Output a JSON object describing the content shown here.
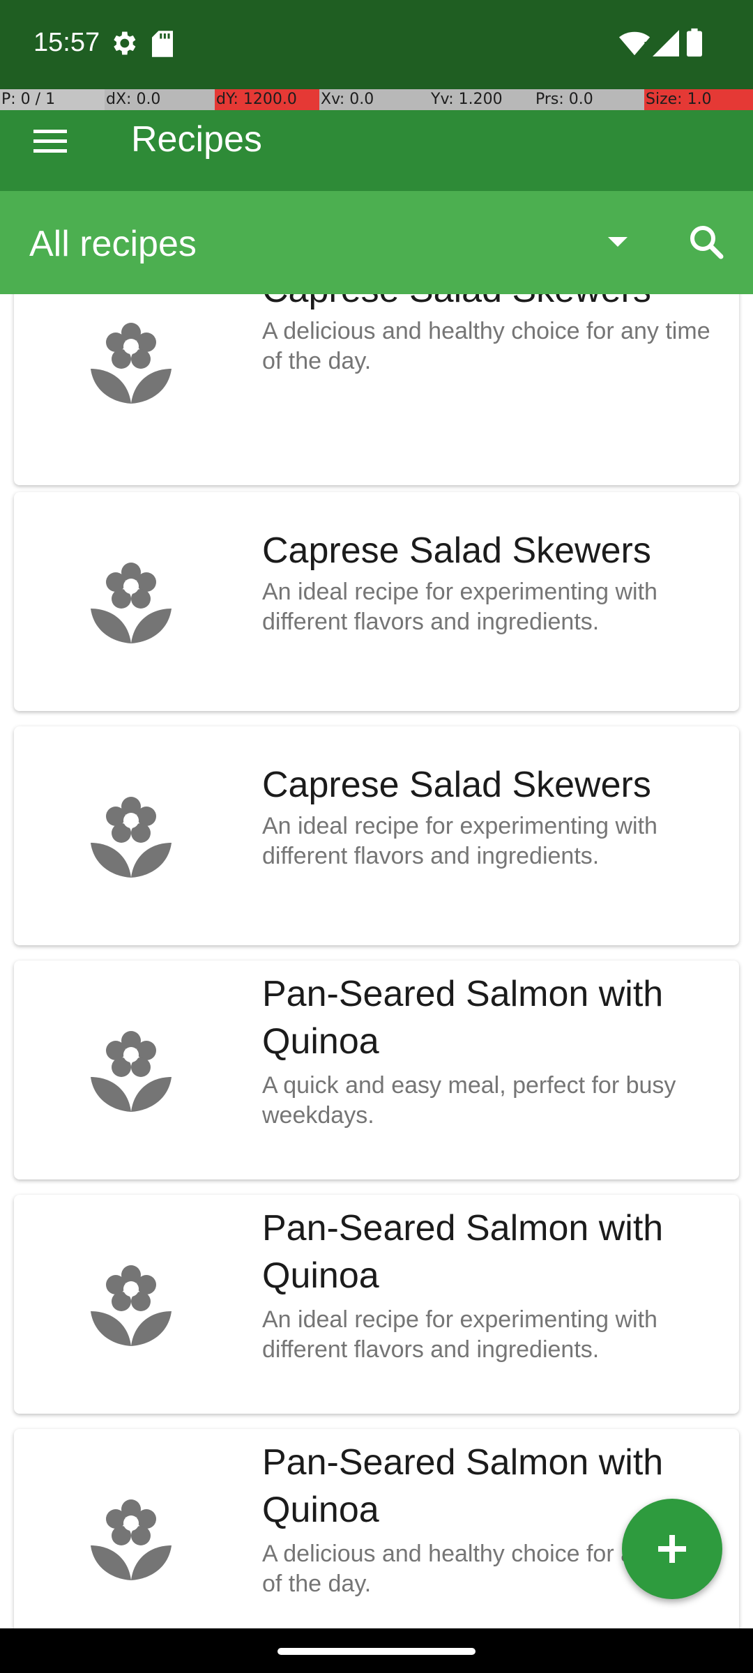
{
  "status_bar": {
    "time": "15:57",
    "icons": [
      "gear-icon",
      "sd-card-icon",
      "wifi-alert-icon",
      "signal-icon",
      "battery-icon"
    ]
  },
  "debug_bar": {
    "p": "P: 0 / 1",
    "dx": "dX: 0.0",
    "dy": "dY: 1200.0",
    "xv": "Xv: 0.0",
    "yv": "Yv: 1.200",
    "prs": "Prs: 0.0",
    "size": "Size: 1.0"
  },
  "app_bar": {
    "title": "Recipes",
    "menu_icon": "hamburger-menu-icon"
  },
  "filter": {
    "selected": "All recipes",
    "search_icon": "search-icon"
  },
  "recipes": [
    {
      "title": "Caprese Salad Skewers",
      "description": "A delicious and healthy choice for any time of the day."
    },
    {
      "title": "Caprese Salad Skewers",
      "description": "An ideal recipe for experimenting with different flavors and ingredients."
    },
    {
      "title": "Caprese Salad Skewers",
      "description": "An ideal recipe for experimenting with different flavors and ingredients."
    },
    {
      "title": "Pan-Seared Salmon with Quinoa",
      "description": "A quick and easy meal, perfect for busy weekdays."
    },
    {
      "title": "Pan-Seared Salmon with Quinoa",
      "description": "An ideal recipe for experimenting with different flavors and ingredients."
    },
    {
      "title": "Pan-Seared Salmon with Quinoa",
      "description": "A delicious and healthy choice for any time of the day."
    }
  ],
  "fab": {
    "icon": "plus-icon"
  },
  "colors": {
    "status_bar": "#1f5e22",
    "app_bar": "#2e8b37",
    "filter_bar": "#4caf50",
    "fab": "#2e9b3e",
    "placeholder_icon": "#757575"
  }
}
